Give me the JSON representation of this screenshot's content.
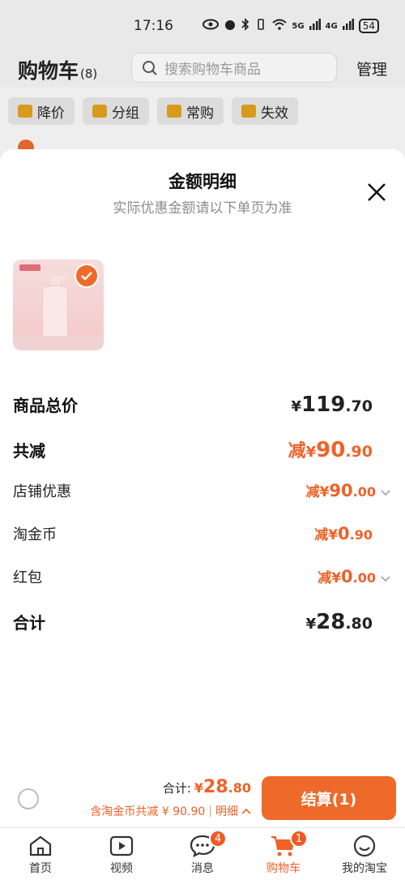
{
  "status_bar": {
    "time": "17:16",
    "network1": "5G",
    "network2": "4G",
    "battery": "54"
  },
  "cart_header": {
    "title": "购物车",
    "count": "(8)",
    "search_placeholder": "搜索购物车商品",
    "manage": "管理"
  },
  "filters": [
    {
      "label": "降价",
      "icon": "price-down-icon"
    },
    {
      "label": "分组",
      "icon": "folder-icon"
    },
    {
      "label": "常购",
      "icon": "cart-icon"
    },
    {
      "label": "失效",
      "icon": "invalid-icon"
    }
  ],
  "sheet": {
    "title": "金额明细",
    "subtitle": "实际优惠金额请以下单页为准",
    "product": {
      "selected": true
    },
    "rows": {
      "goods_total": {
        "label": "商品总价",
        "cur": "¥",
        "int": "119",
        "dec": ".70"
      },
      "total_discount": {
        "label": "共减",
        "prefix": "减",
        "cur": "¥",
        "int": "90",
        "dec": ".90"
      },
      "shop_discount": {
        "label": "店铺优惠",
        "prefix": "减",
        "cur": "¥",
        "int": "90",
        "dec": ".00"
      },
      "coins": {
        "label": "淘金币",
        "prefix": "减",
        "cur": "¥",
        "int": "0",
        "dec": ".90"
      },
      "red_packet": {
        "label": "红包",
        "prefix": "减",
        "cur": "¥",
        "int": "0",
        "dec": ".00"
      },
      "sum": {
        "label": "合计",
        "cur": "¥",
        "int": "28",
        "dec": ".80"
      }
    }
  },
  "checkout": {
    "total_label": "合计:",
    "cur": "¥",
    "int": "28",
    "dec": ".80",
    "sub_text": "含淘金币共减 ¥ 90.90",
    "sep": "|",
    "detail": "明细",
    "pay_button": "结算(1)"
  },
  "tabs": [
    {
      "label": "首页",
      "icon": "home-icon"
    },
    {
      "label": "视频",
      "icon": "video-icon"
    },
    {
      "label": "消息",
      "icon": "message-icon",
      "badge": "4"
    },
    {
      "label": "购物车",
      "icon": "cart-icon",
      "badge": "1",
      "active": true
    },
    {
      "label": "我的淘宝",
      "icon": "profile-icon"
    }
  ],
  "colors": {
    "accent": "#ee6228",
    "button": "#ee6a2b"
  }
}
